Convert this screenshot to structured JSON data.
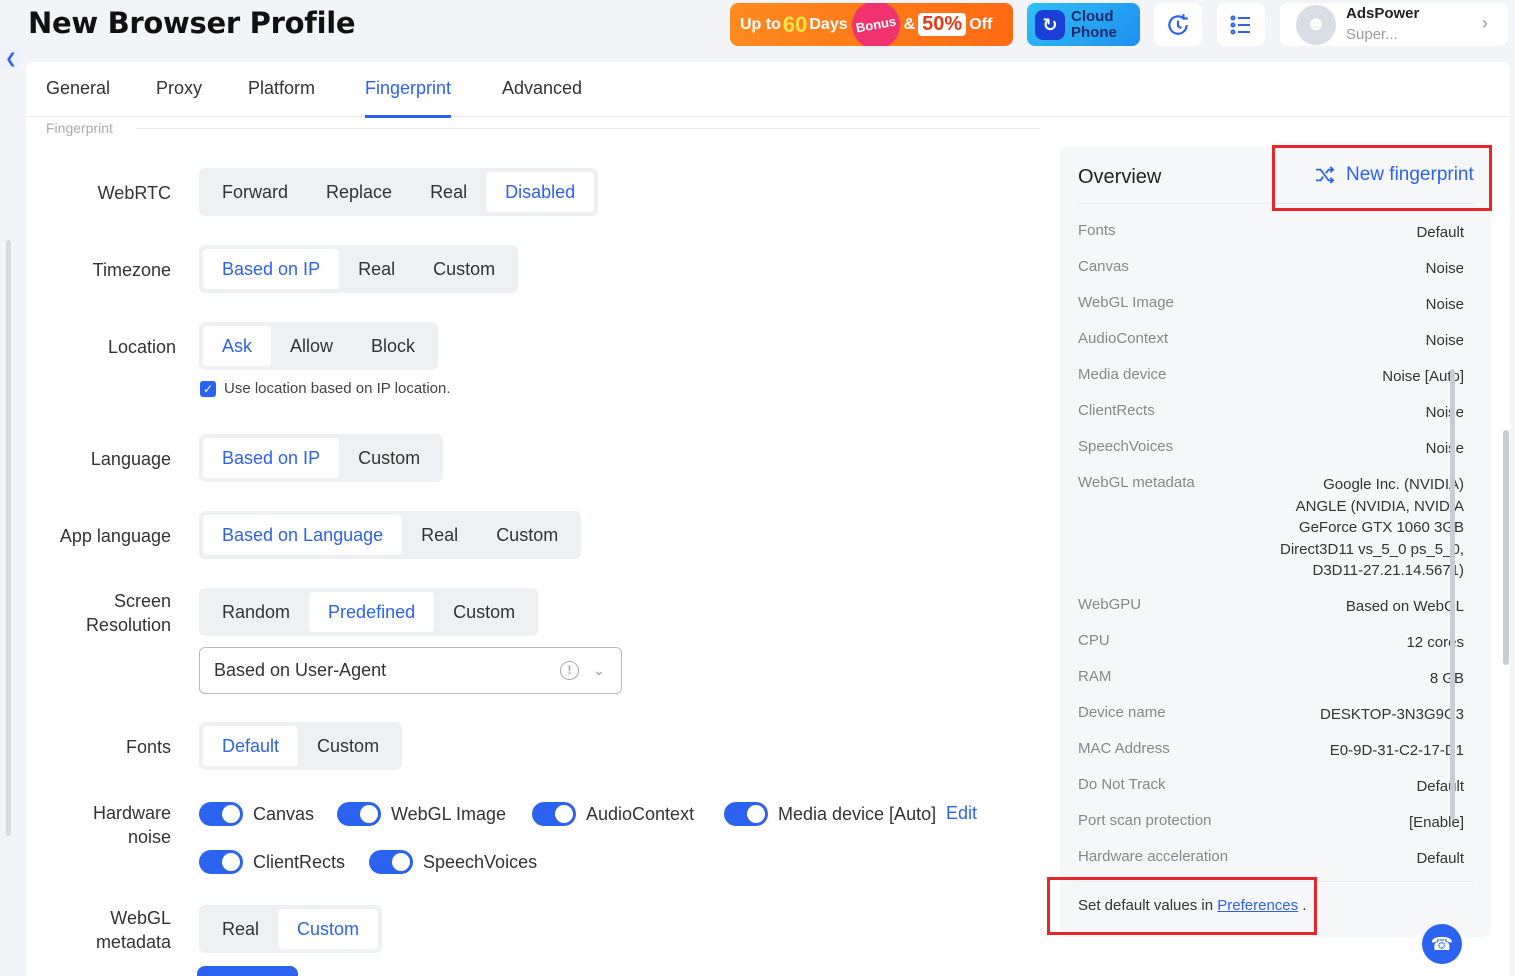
{
  "header": {
    "title": "New Browser Profile",
    "promo": {
      "pre": "Up to",
      "days_num": "60",
      "days_word": "Days",
      "bonus": "Bonus",
      "amp": "&",
      "pct": "50%",
      "off": "Off"
    },
    "cloud": {
      "line1": "Cloud",
      "line2": "Phone"
    },
    "user": {
      "name": "AdsPower",
      "plan": "Super..."
    }
  },
  "tabs": [
    "General",
    "Proxy",
    "Platform",
    "Fingerprint",
    "Advanced"
  ],
  "active_tab": "Fingerprint",
  "section_title": "Fingerprint",
  "form": {
    "webrtc": {
      "label": "WebRTC",
      "options": [
        "Forward",
        "Replace",
        "Real",
        "Disabled"
      ],
      "selected": "Disabled"
    },
    "timezone": {
      "label": "Timezone",
      "options": [
        "Based on IP",
        "Real",
        "Custom"
      ],
      "selected": "Based on IP"
    },
    "location": {
      "label": "Location",
      "options": [
        "Ask",
        "Allow",
        "Block"
      ],
      "selected": "Ask",
      "checkbox_label": "Use location based on IP location.",
      "checkbox_checked": true
    },
    "language": {
      "label": "Language",
      "options": [
        "Based on IP",
        "Custom"
      ],
      "selected": "Based on IP"
    },
    "app_language": {
      "label": "App language",
      "options": [
        "Based on Language",
        "Real",
        "Custom"
      ],
      "selected": "Based on Language"
    },
    "screen_resolution": {
      "label_line1": "Screen",
      "label_line2": "Resolution",
      "options": [
        "Random",
        "Predefined",
        "Custom"
      ],
      "selected": "Predefined",
      "select_value": "Based on User-Agent"
    },
    "fonts": {
      "label": "Fonts",
      "options": [
        "Default",
        "Custom"
      ],
      "selected": "Default"
    },
    "hardware_noise": {
      "label_line1": "Hardware",
      "label_line2": "noise",
      "toggles": [
        "Canvas",
        "WebGL Image",
        "AudioContext",
        "Media device [Auto]",
        "ClientRects",
        "SpeechVoices"
      ],
      "edit_label": "Edit"
    },
    "webgl_metadata": {
      "label_line1": "WebGL",
      "label_line2": "metadata",
      "options": [
        "Real",
        "Custom"
      ],
      "selected": "Custom"
    }
  },
  "overview": {
    "title": "Overview",
    "new_fingerprint": "New fingerprint",
    "rows": [
      {
        "key": "Fonts",
        "value": "Default"
      },
      {
        "key": "Canvas",
        "value": "Noise"
      },
      {
        "key": "WebGL Image",
        "value": "Noise"
      },
      {
        "key": "AudioContext",
        "value": "Noise"
      },
      {
        "key": "Media device",
        "value": "Noise [Auto]"
      },
      {
        "key": "ClientRects",
        "value": "Noise"
      },
      {
        "key": "SpeechVoices",
        "value": "Noise"
      },
      {
        "key": "WebGL metadata",
        "value": "Google Inc. (NVIDIA)\nANGLE (NVIDIA, NVIDIA\nGeForce GTX 1060 3GB\nDirect3D11 vs_5_0 ps_5_0,\nD3D11-27.21.14.5671)"
      },
      {
        "key": "WebGPU",
        "value": "Based on WebGL"
      },
      {
        "key": "CPU",
        "value": "12 cores"
      },
      {
        "key": "RAM",
        "value": "8 GB"
      },
      {
        "key": "Device name",
        "value": "DESKTOP-3N3G9G3"
      },
      {
        "key": "MAC Address",
        "value": "E0-9D-31-C2-17-D1"
      },
      {
        "key": "Do Not Track",
        "value": "Default"
      },
      {
        "key": "Port scan protection",
        "value": "[Enable]"
      },
      {
        "key": "Hardware acceleration",
        "value": "Default"
      }
    ],
    "footer_prefix": "Set default values in",
    "footer_link": "Preferences",
    "footer_suffix": "."
  },
  "colors": {
    "accent": "#2b62f0",
    "highlight": "#e6262b",
    "promo": "#ff6a13"
  },
  "icons": [
    "chevron-left-icon",
    "sync-icon",
    "list-icon",
    "avatar-icon",
    "chevron-right-icon",
    "shuffle-icon",
    "info-icon",
    "chevron-down-icon",
    "headset-icon",
    "check-icon"
  ]
}
